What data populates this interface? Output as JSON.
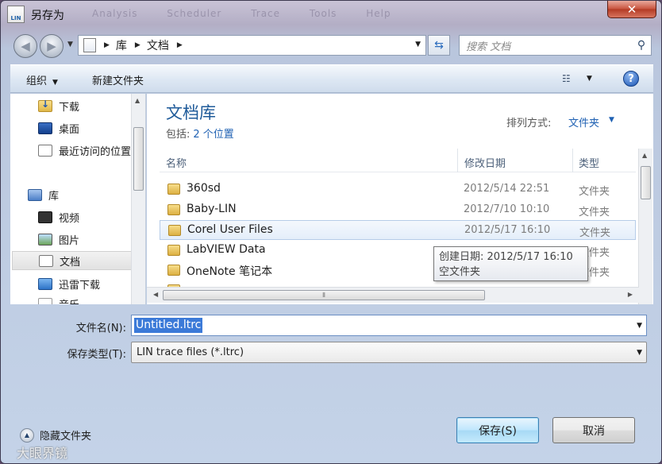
{
  "window": {
    "title": "另存为",
    "app_icon_text": "LIN",
    "close_symbol": "✕",
    "ghost_menu": [
      "Analysis",
      "Scheduler",
      "Trace",
      "Tools",
      "Help"
    ]
  },
  "address_bar": {
    "breadcrumbs": [
      "库",
      "文档"
    ]
  },
  "search": {
    "placeholder": "搜索 文档"
  },
  "toolbar": {
    "organize_label": "组织",
    "new_folder_label": "新建文件夹",
    "help_symbol": "?"
  },
  "nav_pane": {
    "items": [
      {
        "label": "下载",
        "icon": "download-folder-icon"
      },
      {
        "label": "桌面",
        "icon": "desktop-icon"
      },
      {
        "label": "最近访问的位置",
        "icon": "recent-places-icon"
      },
      {
        "label": "库",
        "icon": "library-icon"
      },
      {
        "label": "视频",
        "icon": "video-library-icon"
      },
      {
        "label": "图片",
        "icon": "pictures-library-icon"
      },
      {
        "label": "文档",
        "icon": "documents-library-icon",
        "selected": true
      },
      {
        "label": "迅雷下载",
        "icon": "thunder-download-icon"
      },
      {
        "label": "音乐",
        "icon": "music-library-icon"
      }
    ]
  },
  "library": {
    "title": "文档库",
    "includes_label": "包括:",
    "includes_link": "2 个位置",
    "arrange_label": "排列方式:",
    "arrange_value": "文件夹"
  },
  "columns": {
    "name": "名称",
    "date": "修改日期",
    "type": "类型"
  },
  "files": [
    {
      "name": "360sd",
      "date": "2012/5/14 22:51",
      "type": "文件夹"
    },
    {
      "name": "Baby-LIN",
      "date": "2012/7/10 10:10",
      "type": "文件夹"
    },
    {
      "name": "Corel User Files",
      "date": "2012/5/17 16:10",
      "type": "文件夹"
    },
    {
      "name": "LabVIEW Data",
      "date": "",
      "type": "文件夹"
    },
    {
      "name": "OneNote 笔记本",
      "date": "",
      "type": "文件夹"
    },
    {
      "name": "",
      "date": "",
      "type": ""
    }
  ],
  "tooltip": {
    "line1": "创建日期: 2012/5/17 16:10",
    "line2": "空文件夹"
  },
  "form": {
    "filename_label": "文件名(N):",
    "filename_value": "Untitled.ltrc",
    "filetype_label": "保存类型(T):",
    "filetype_value": "LIN trace files (*.ltrc)"
  },
  "footer": {
    "hide_folders_label": "隐藏文件夹",
    "save_label": "保存(S)",
    "cancel_label": "取消",
    "watermark": "大眼界镜"
  }
}
